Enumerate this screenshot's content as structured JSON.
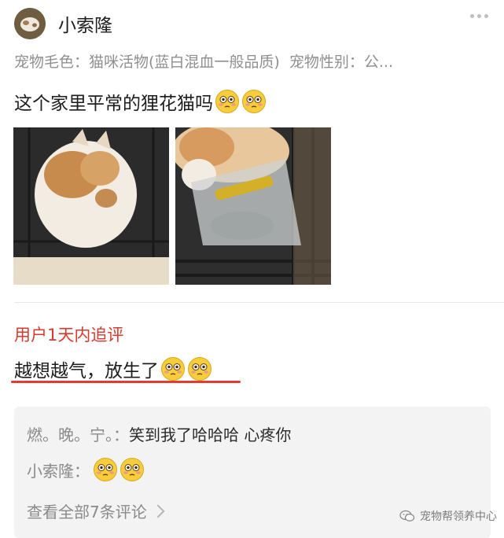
{
  "header": {
    "username": "小索隆"
  },
  "meta": {
    "coat_label": "宠物毛色：",
    "coat_value": "猫咪活物(蓝白混血一般品质)",
    "gender_label": "宠物性别：",
    "gender_value": "公..."
  },
  "post": {
    "text": "这个家里平常的狸花猫吗"
  },
  "followup": {
    "label": "用户1天内追评",
    "text": "越想越气，放生了"
  },
  "comments": [
    {
      "name": "燃。晚。宁。：",
      "body": "笑到我了哈哈哈 心疼你"
    },
    {
      "name": "小索隆：",
      "body": ""
    }
  ],
  "view_all": "查看全部7条评论",
  "watermark": "宠物帮领养中心",
  "colors": {
    "accent_red": "#d83a2f",
    "underline_red": "#e23b34",
    "comment_bg": "#f3f3f3",
    "meta_gray": "#8f8f8f"
  }
}
